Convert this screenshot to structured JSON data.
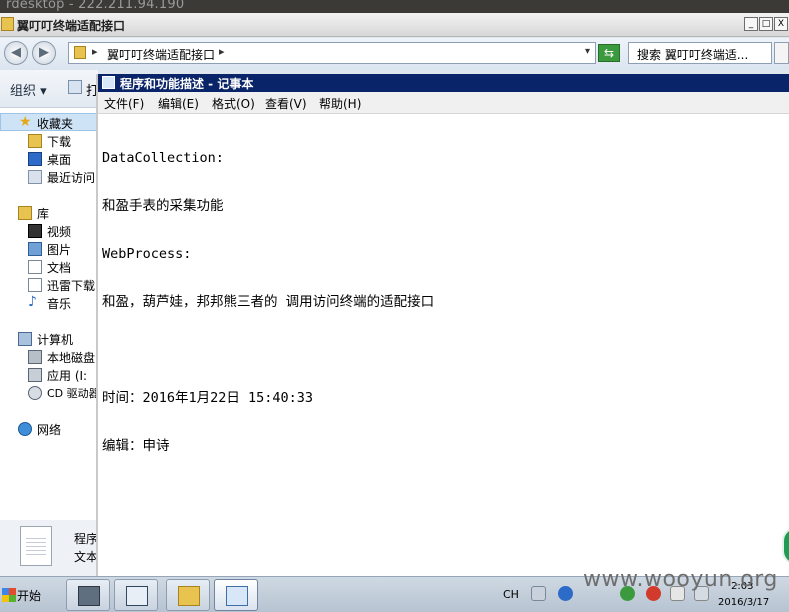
{
  "rdesktop": {
    "title": "rdesktop - 222.211.94.190"
  },
  "explorer": {
    "title": "翼叮叮终端适配接口",
    "window_buttons": {
      "minimize": "_",
      "maximize": "□",
      "close": "X"
    },
    "nav": {
      "back": "◀",
      "forward": "▶"
    },
    "address": {
      "separator": "▸",
      "path": "翼叮叮终端适配接口",
      "trailing": "▸",
      "dropdown": "▾"
    },
    "search": {
      "label": "搜索 翼叮叮终端适..."
    },
    "toolbar": {
      "organize": "组织 ▾",
      "extra": "打"
    },
    "sidebar": {
      "favorites": "收藏夹",
      "downloads": "下载",
      "desktop": "桌面",
      "recent": "最近访问",
      "libraries": "库",
      "videos": "视频",
      "pictures": "图片",
      "documents": "文档",
      "thunder": "迅雷下载",
      "music": "音乐",
      "computer": "计算机",
      "local_disk": "本地磁盘",
      "app_drive": "应用 (I:",
      "cd_drive": "CD 驱动器",
      "network": "网络"
    },
    "details": {
      "line1": "程序",
      "line2": "文本"
    }
  },
  "notepad": {
    "title": "程序和功能描述 - 记事本",
    "menu": [
      "文件(F)",
      "编辑(E)",
      "格式(O)",
      "查看(V)",
      "帮助(H)"
    ],
    "lines": [
      "DataCollection:",
      "和盈手表的采集功能",
      "WebProcess:",
      "和盈，葫芦娃，邦邦熊三者的 调用访问终端的适配接口",
      "",
      "时间：2016年1月22日 15:40:33",
      "编辑：申诗"
    ]
  },
  "taskbar": {
    "start": "开始",
    "lang": "CH",
    "time": "2:03",
    "date": "2016/3/17"
  },
  "watermark": "www.wooyun.org"
}
